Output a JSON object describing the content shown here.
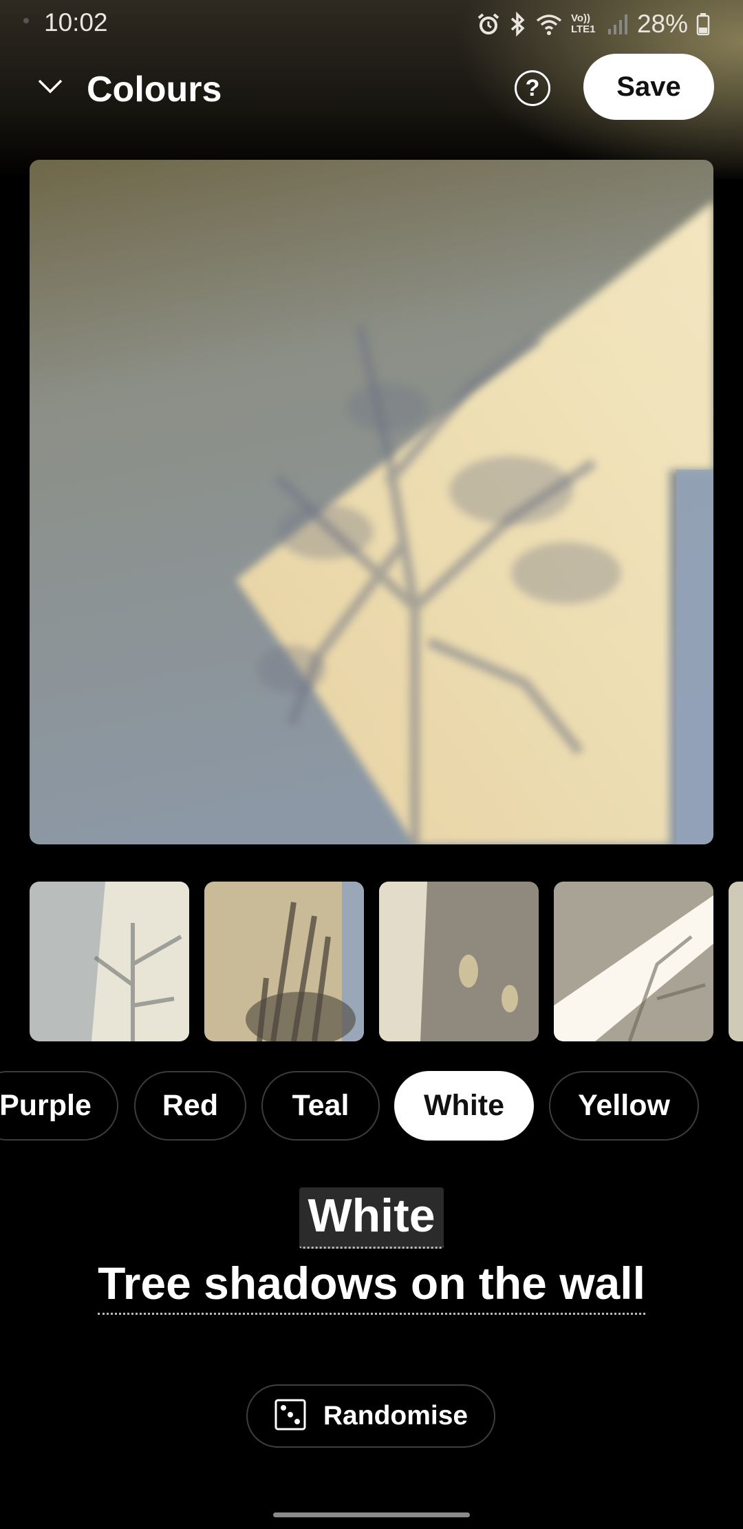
{
  "status_bar": {
    "time": "10:02",
    "network_label": "Vo)) LTE1",
    "battery": "28%",
    "icons": [
      "alarm-icon",
      "bluetooth-icon",
      "wifi-icon",
      "signal-icon",
      "battery-icon"
    ]
  },
  "header": {
    "title": "Colours",
    "save_label": "Save",
    "help_label": "?"
  },
  "thumbnails": [
    {
      "index": 1,
      "tone": "grey"
    },
    {
      "index": 2,
      "tone": "beige"
    },
    {
      "index": 3,
      "tone": "grey-gold"
    },
    {
      "index": 4,
      "tone": "white"
    },
    {
      "index": 5,
      "tone": "partial"
    }
  ],
  "chips": [
    {
      "label": "Purple",
      "selected": false
    },
    {
      "label": "Red",
      "selected": false
    },
    {
      "label": "Teal",
      "selected": false
    },
    {
      "label": "White",
      "selected": true
    },
    {
      "label": "Yellow",
      "selected": false
    }
  ],
  "caption": {
    "title": "White",
    "subtitle": "Tree shadows on the wall"
  },
  "randomise": {
    "label": "Randomise"
  },
  "colors": {
    "background": "#000000",
    "accent": "#ffffff",
    "chip_border": "#3c3c3c"
  }
}
